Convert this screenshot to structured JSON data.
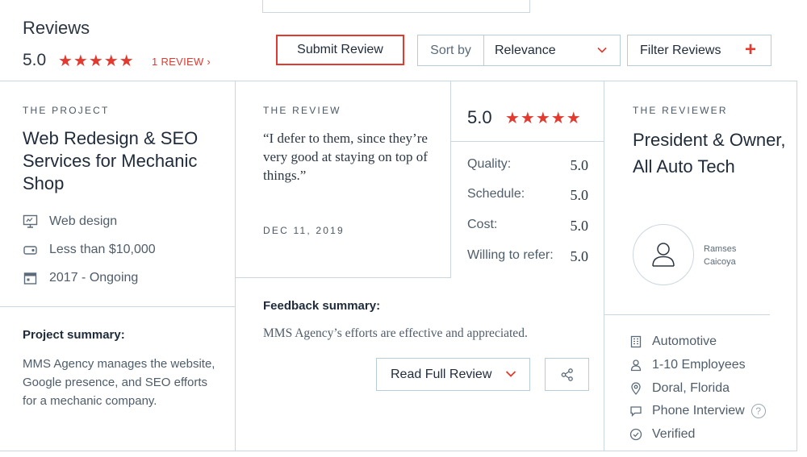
{
  "header": {
    "title": "Reviews",
    "rating": "5.0",
    "stars": "★★★★★",
    "review_count": "1 REVIEW  ›",
    "submit_label": "Submit Review",
    "sort_label": "Sort by",
    "sort_value": "Relevance",
    "filter_label": "Filter Reviews",
    "filter_plus": "+"
  },
  "project": {
    "section_label": "THE PROJECT",
    "title": "Web Redesign & SEO Services for Mechanic Shop",
    "service": "Web design",
    "budget": "Less than $10,000",
    "dates": "2017 - Ongoing",
    "summary_label": "Project summary:",
    "summary_text": "MMS Agency manages the website, Google presence, and SEO efforts for a mechanic company."
  },
  "review": {
    "section_label": "THE REVIEW",
    "quote": "“I defer to them, since they’re very good at staying on top of things.”",
    "date": "DEC 11, 2019",
    "overall": "5.0",
    "stars": "★★★★★",
    "scores": [
      {
        "label": "Quality:",
        "value": "5.0"
      },
      {
        "label": "Schedule:",
        "value": "5.0"
      },
      {
        "label": "Cost:",
        "value": "5.0"
      },
      {
        "label": "Willing to refer:",
        "value": "5.0"
      }
    ],
    "feedback_label": "Feedback summary:",
    "feedback_text": "MMS Agency’s efforts are effective and appreciated.",
    "read_full_label": "Read Full Review"
  },
  "reviewer": {
    "section_label": "THE REVIEWER",
    "title": "President & Owner, All Auto Tech",
    "name_first": "Ramses",
    "name_last": "Caicoya",
    "industry": "Automotive",
    "employees": "1-10 Employees",
    "location": "Doral, Florida",
    "interview": "Phone Interview",
    "help": "?",
    "verified": "Verified"
  },
  "colors": {
    "accent": "#e33a2f",
    "border": "#cbd7e0",
    "text": "#1f2b3a",
    "muted": "#4f5d6b"
  },
  "icons": {
    "service": "monitor-icon",
    "budget": "price-tag-icon",
    "dates": "calendar-icon",
    "industry": "building-icon",
    "employees": "user-icon",
    "location": "map-pin-icon",
    "interview": "chat-bubble-icon",
    "verified": "check-circle-icon",
    "share": "share-icon"
  }
}
